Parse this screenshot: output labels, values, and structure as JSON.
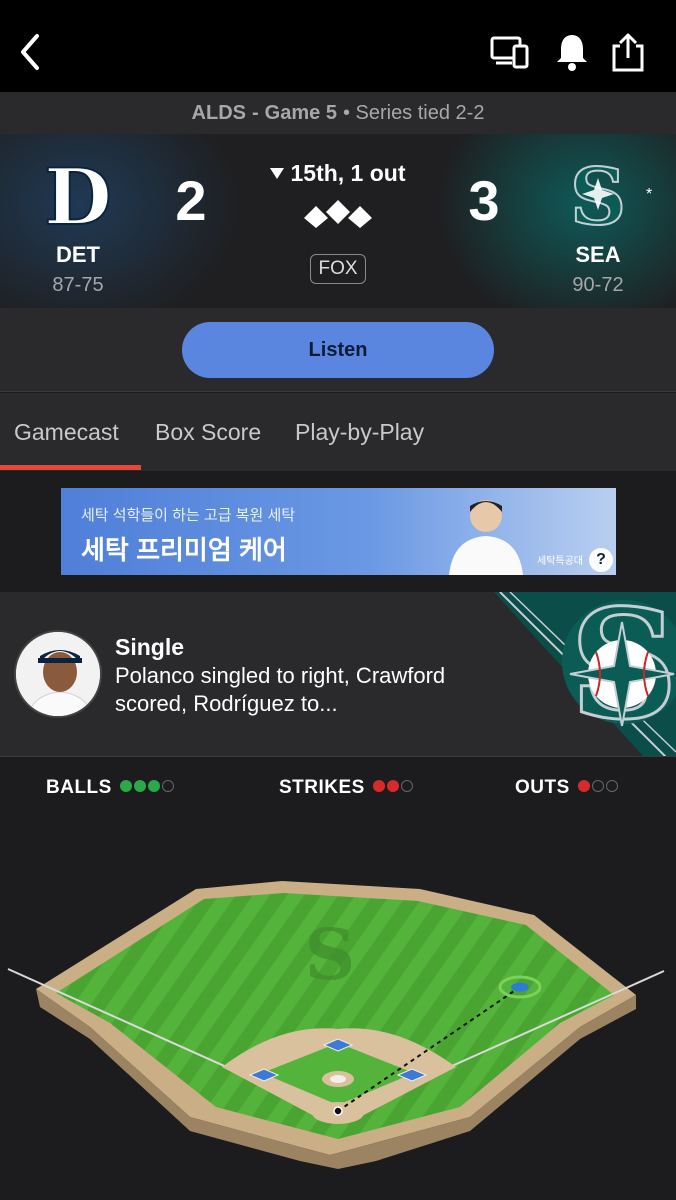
{
  "header": {
    "icons": [
      "back-arrow-icon",
      "devices-icon",
      "bell-icon",
      "share-icon"
    ]
  },
  "series_bar": {
    "round": "ALDS",
    "separator": "-",
    "game": "Game 5",
    "status": "• Series tied 2-2"
  },
  "scoreboard": {
    "away": {
      "abbr": "DET",
      "record": "87-75",
      "runs": "2"
    },
    "home": {
      "abbr": "SEA",
      "record": "90-72",
      "runs": "3",
      "marker": "*"
    },
    "inning": "15th, 1 out",
    "broadcast": "FOX"
  },
  "listen_button": "Listen",
  "tabs": [
    {
      "label": "Gamecast",
      "active": true
    },
    {
      "label": "Box Score",
      "active": false
    },
    {
      "label": "Play-by-Play",
      "active": false
    }
  ],
  "ad": {
    "line1": "세탁 석학들이 하는 고급 복원 세탁",
    "line2": "세탁 프리미엄 케어",
    "brand": "세탁특공대",
    "info": "?"
  },
  "last_play": {
    "type": "Single",
    "description": "Polanco singled to right, Crawford scored, Rodríguez to..."
  },
  "count": {
    "balls_label": "BALLS",
    "strikes_label": "STRIKES",
    "outs_label": "OUTS",
    "balls": 3,
    "strikes": 2,
    "outs": 1
  },
  "colors": {
    "accent_tab": "#e2493a",
    "listen_button": "#5b86e0",
    "ball_dot": "#2aa84a",
    "strike_out_dot": "#d62b2b"
  }
}
